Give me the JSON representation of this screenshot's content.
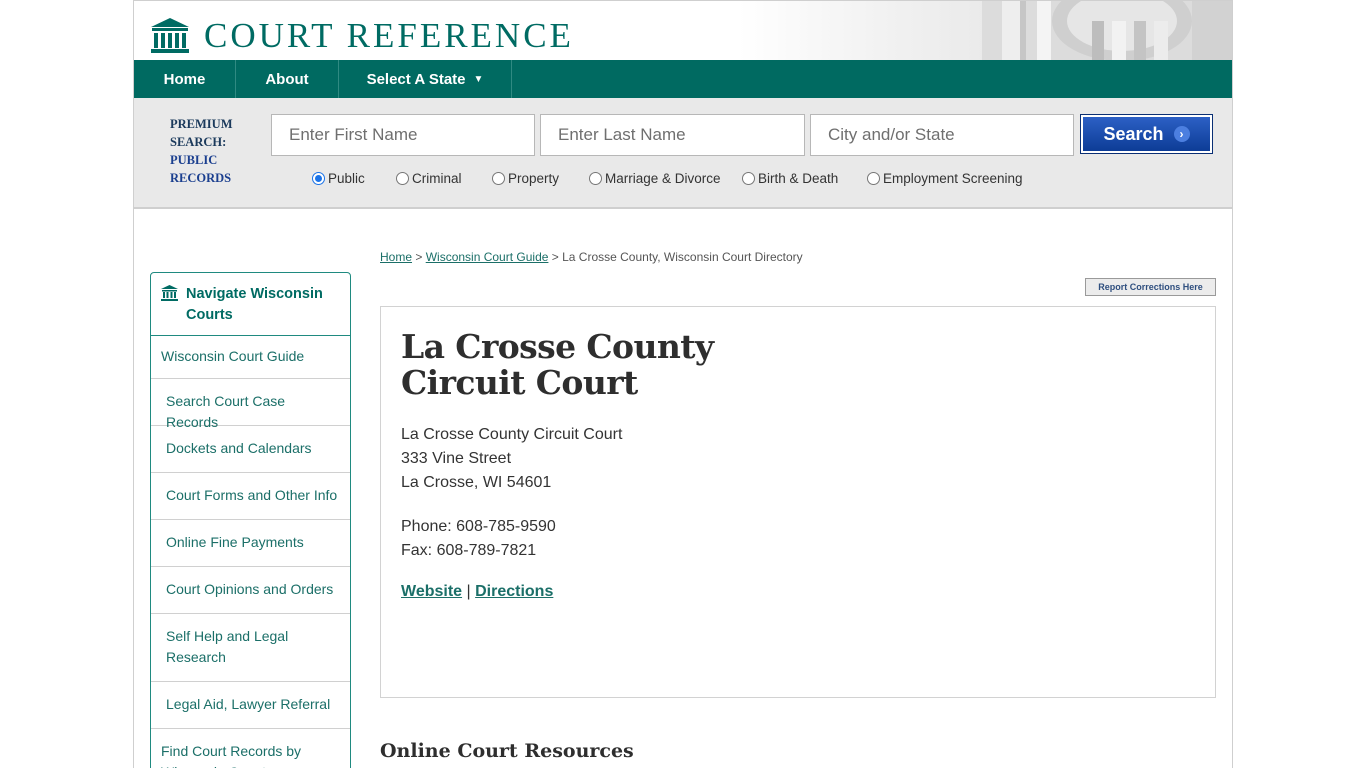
{
  "brand": {
    "name": "COURT REFERENCE"
  },
  "nav": {
    "home": "Home",
    "about": "About",
    "select_state": "Select A State"
  },
  "search": {
    "premium_line1": "PREMIUM",
    "premium_line2": "SEARCH:",
    "premium_line3": "PUBLIC",
    "premium_line4": "RECORDS",
    "first_name_placeholder": "Enter First Name",
    "last_name_placeholder": "Enter Last Name",
    "city_state_placeholder": "City and/or State",
    "button_label": "Search",
    "options": [
      {
        "label": "Public",
        "selected": true
      },
      {
        "label": "Criminal",
        "selected": false
      },
      {
        "label": "Property",
        "selected": false
      },
      {
        "label": "Marriage & Divorce",
        "selected": false
      },
      {
        "label": "Birth & Death",
        "selected": false
      },
      {
        "label": "Employment Screening",
        "selected": false
      }
    ]
  },
  "breadcrumb": {
    "home": "Home",
    "sep1": " > ",
    "guide": "Wisconsin Court Guide",
    "sep2": " > ",
    "current": "La Crosse County, Wisconsin Court Directory"
  },
  "report_button": "Report Corrections Here",
  "sidebar": {
    "title_line1": "Navigate Wisconsin",
    "title_line2": "Courts",
    "items": [
      "Wisconsin Court Guide",
      "Search Court Case Records",
      "Dockets and Calendars",
      "Court Forms and Other Info",
      "Online Fine Payments",
      "Court Opinions and Orders",
      "Self Help and Legal Research",
      "Legal Aid, Lawyer Referral",
      "Find Court Records by Wisconsin County"
    ]
  },
  "court": {
    "title_line1": "La Crosse County",
    "title_line2": "Circuit Court",
    "address_name": "La Crosse County Circuit Court",
    "address_street": "333 Vine Street",
    "address_city": "La Crosse, WI 54601",
    "phone": "Phone: 608-785-9590",
    "fax": "Fax: 608-789-7821",
    "website_label": "Website",
    "link_sep": " | ",
    "directions_label": "Directions"
  },
  "section_heading": "Online Court Resources",
  "colors": {
    "brand_teal": "#006a61",
    "search_blue": "#0b3a93",
    "link_teal": "#1b6f68"
  },
  "icons": {
    "logo": "courthouse-icon",
    "sidebar": "courthouse-icon",
    "search_arrow": "chevron-right-icon",
    "nav_caret": "caret-down-icon"
  }
}
